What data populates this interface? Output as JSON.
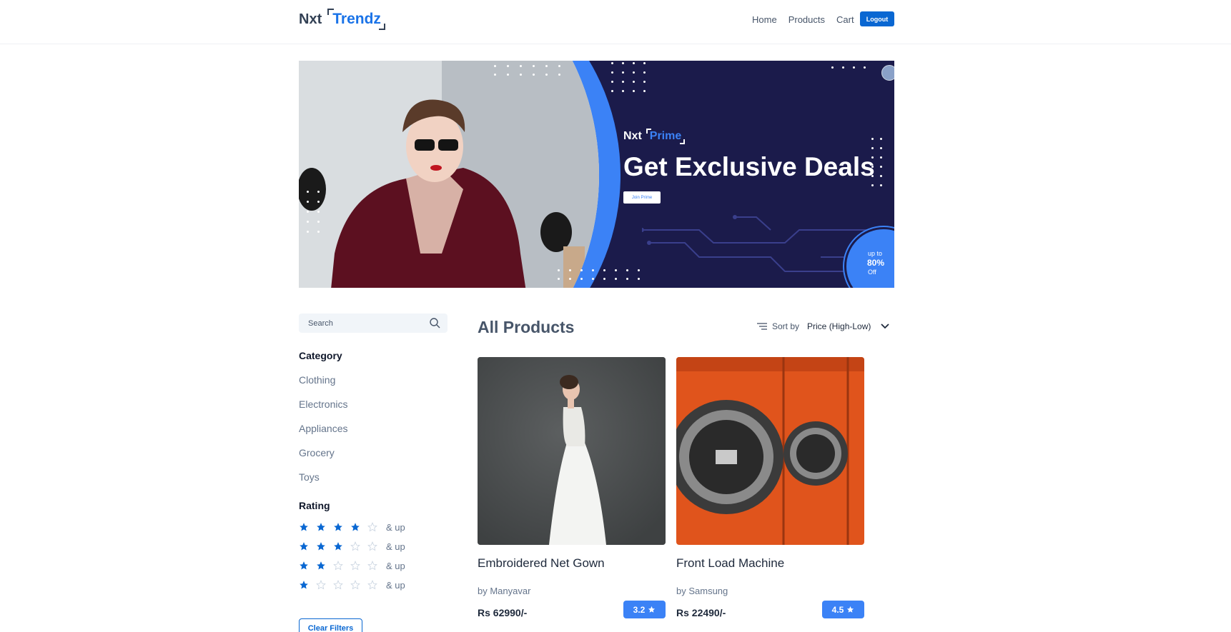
{
  "header": {
    "logo_nxt": "Nxt",
    "logo_trendz": "Trendz",
    "nav": [
      "Home",
      "Products",
      "Cart"
    ],
    "logout_label": "Logout"
  },
  "banner": {
    "prime_nxt": "Nxt",
    "prime_word": "Prime",
    "headline": "Get Exclusive Deals",
    "join_label": "Join Prime",
    "offer_line1": "up to",
    "offer_line2": "80%",
    "offer_line3": "Off"
  },
  "sidebar": {
    "search_placeholder": "Search",
    "category_heading": "Category",
    "categories": [
      "Clothing",
      "Electronics",
      "Appliances",
      "Grocery",
      "Toys"
    ],
    "rating_heading": "Rating",
    "ratings": [
      {
        "stars": 4,
        "label": "& up"
      },
      {
        "stars": 3,
        "label": "& up"
      },
      {
        "stars": 2,
        "label": "& up"
      },
      {
        "stars": 1,
        "label": "& up"
      }
    ],
    "clear_label": "Clear Filters"
  },
  "products": {
    "title": "All Products",
    "sort_label": "Sort by",
    "sort_value": "Price (High-Low)",
    "items": [
      {
        "name": "Embroidered Net Gown",
        "brand": "by Manyavar",
        "price": "Rs 62990/-",
        "rating": "3.2"
      },
      {
        "name": "Front Load Machine",
        "brand": "by Samsung",
        "price": "Rs 22490/-",
        "rating": "4.5"
      }
    ]
  },
  "colors": {
    "accent": "#0967d2",
    "banner_bg": "#1b1b4b",
    "rating_badge": "#3b82f6"
  }
}
